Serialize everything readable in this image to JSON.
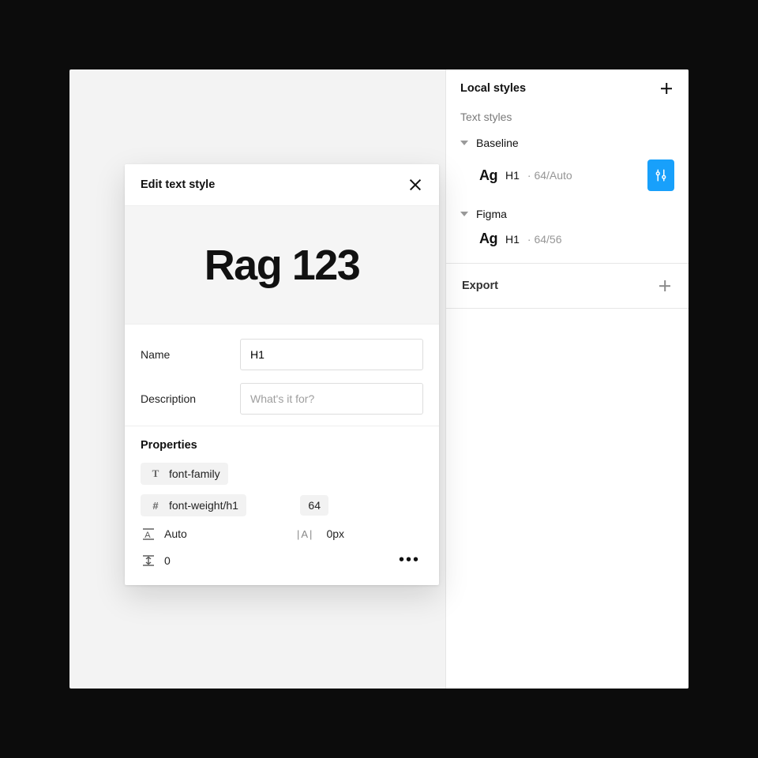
{
  "sidebar": {
    "title": "Local styles",
    "section_label": "Text styles",
    "groups": [
      {
        "name": "Baseline",
        "items": [
          {
            "swatch": "Ag",
            "name": "H1",
            "meta": "· 64/Auto",
            "active": true
          }
        ]
      },
      {
        "name": "Figma",
        "items": [
          {
            "swatch": "Ag",
            "name": "H1",
            "meta": "· 64/56",
            "active": false
          }
        ]
      }
    ],
    "export_label": "Export"
  },
  "edit_panel": {
    "title": "Edit text style",
    "preview_text": "Rag 123",
    "name_label": "Name",
    "name_value": "H1",
    "description_label": "Description",
    "description_placeholder": "What's it for?",
    "properties": {
      "heading": "Properties",
      "font_family_label": "font-family",
      "font_weight_label": "font-weight/h1",
      "font_weight_value": "64",
      "line_height_value": "Auto",
      "letter_spacing_value": "0px",
      "paragraph_spacing_value": "0"
    }
  }
}
